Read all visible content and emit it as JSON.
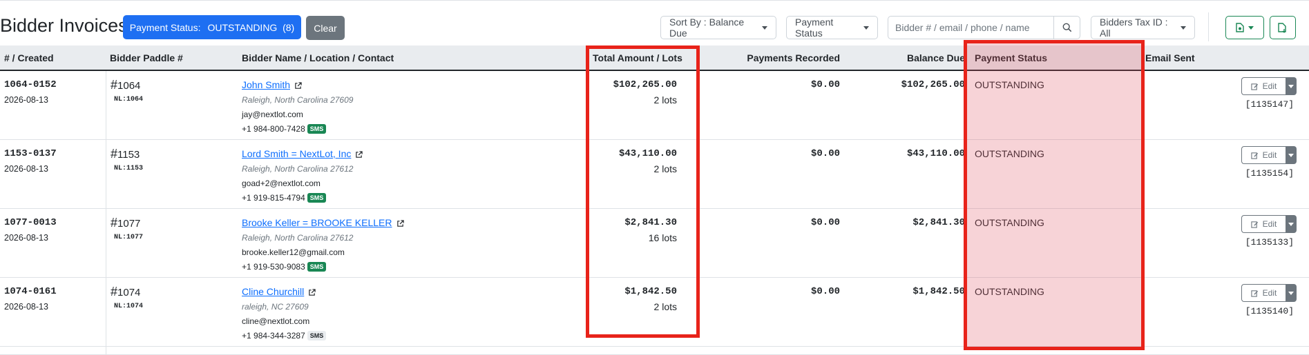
{
  "page": {
    "title": "Bidder Invoices"
  },
  "toolbar": {
    "filter_label": "Payment Status:",
    "filter_value": "OUTSTANDING",
    "filter_count": "(8)",
    "clear_label": "Clear",
    "sort_label": "Sort By : Balance Due",
    "payment_status_label": "Payment Status",
    "search_placeholder": "Bidder # / email / phone / name",
    "tax_id_label": "Bidders Tax ID : All"
  },
  "columns": {
    "created": "# / Created",
    "paddle": "Bidder Paddle #",
    "name": "Bidder Name / Location / Contact",
    "total": "Total Amount / Lots",
    "payments": "Payments Recorded",
    "balance": "Balance Due",
    "status": "Payment Status",
    "email_sent": "Email Sent"
  },
  "rows": [
    {
      "invoice": "1064-0152",
      "created": "2026-08-13",
      "hash": "#",
      "paddle": "1064",
      "nl": "NL:1064",
      "name": "John Smith",
      "location": "Raleigh, North Carolina 27609",
      "email": "jay@nextlot.com",
      "phone": "+1 984-800-7428",
      "sms": "SMS",
      "sms_enabled": true,
      "total": "$102,265.00",
      "lots": "2 lots",
      "payments": "$0.00",
      "balance": "$102,265.00",
      "status": "OUTSTANDING",
      "edit": "Edit",
      "id": "[1135147]"
    },
    {
      "invoice": "1153-0137",
      "created": "2026-08-13",
      "hash": "#",
      "paddle": "1153",
      "nl": "NL:1153",
      "name": "Lord Smith = NextLot, Inc",
      "location": "Raleigh, North Carolina 27612",
      "email": "goad+2@nextlot.com",
      "phone": "+1 919-815-4794",
      "sms": "SMS",
      "sms_enabled": true,
      "total": "$43,110.00",
      "lots": "2 lots",
      "payments": "$0.00",
      "balance": "$43,110.00",
      "status": "OUTSTANDING",
      "edit": "Edit",
      "id": "[1135154]"
    },
    {
      "invoice": "1077-0013",
      "created": "2026-08-13",
      "hash": "#",
      "paddle": "1077",
      "nl": "NL:1077",
      "name": "Brooke Keller = BROOKE KELLER",
      "location": "Raleigh, North Carolina 27612",
      "email": "brooke.keller12@gmail.com",
      "phone": "+1 919-530-9083",
      "sms": "SMS",
      "sms_enabled": true,
      "total": "$2,841.30",
      "lots": "16 lots",
      "payments": "$0.00",
      "balance": "$2,841.30",
      "status": "OUTSTANDING",
      "edit": "Edit",
      "id": "[1135133]"
    },
    {
      "invoice": "1074-0161",
      "created": "2026-08-13",
      "hash": "#",
      "paddle": "1074",
      "nl": "NL:1074",
      "name": "Cline Churchill",
      "location": "raleigh, NC 27609",
      "email": "cline@nextlot.com",
      "phone": "+1 984-344-3287",
      "sms": "SMS",
      "sms_enabled": false,
      "total": "$1,842.50",
      "lots": "2 lots",
      "payments": "$0.00",
      "balance": "$1,842.50",
      "status": "OUTSTANDING",
      "edit": "Edit",
      "id": "[1135140]"
    }
  ],
  "colors": {
    "highlight_border": "#e8231a",
    "highlight_fill": "#f3c8cf",
    "primary": "#1e6ff2",
    "link": "#0d6efd",
    "success": "#198754"
  },
  "icons": [
    "external-link-icon",
    "search-icon",
    "edit-icon",
    "file-export-icon",
    "file-download-icon"
  ]
}
